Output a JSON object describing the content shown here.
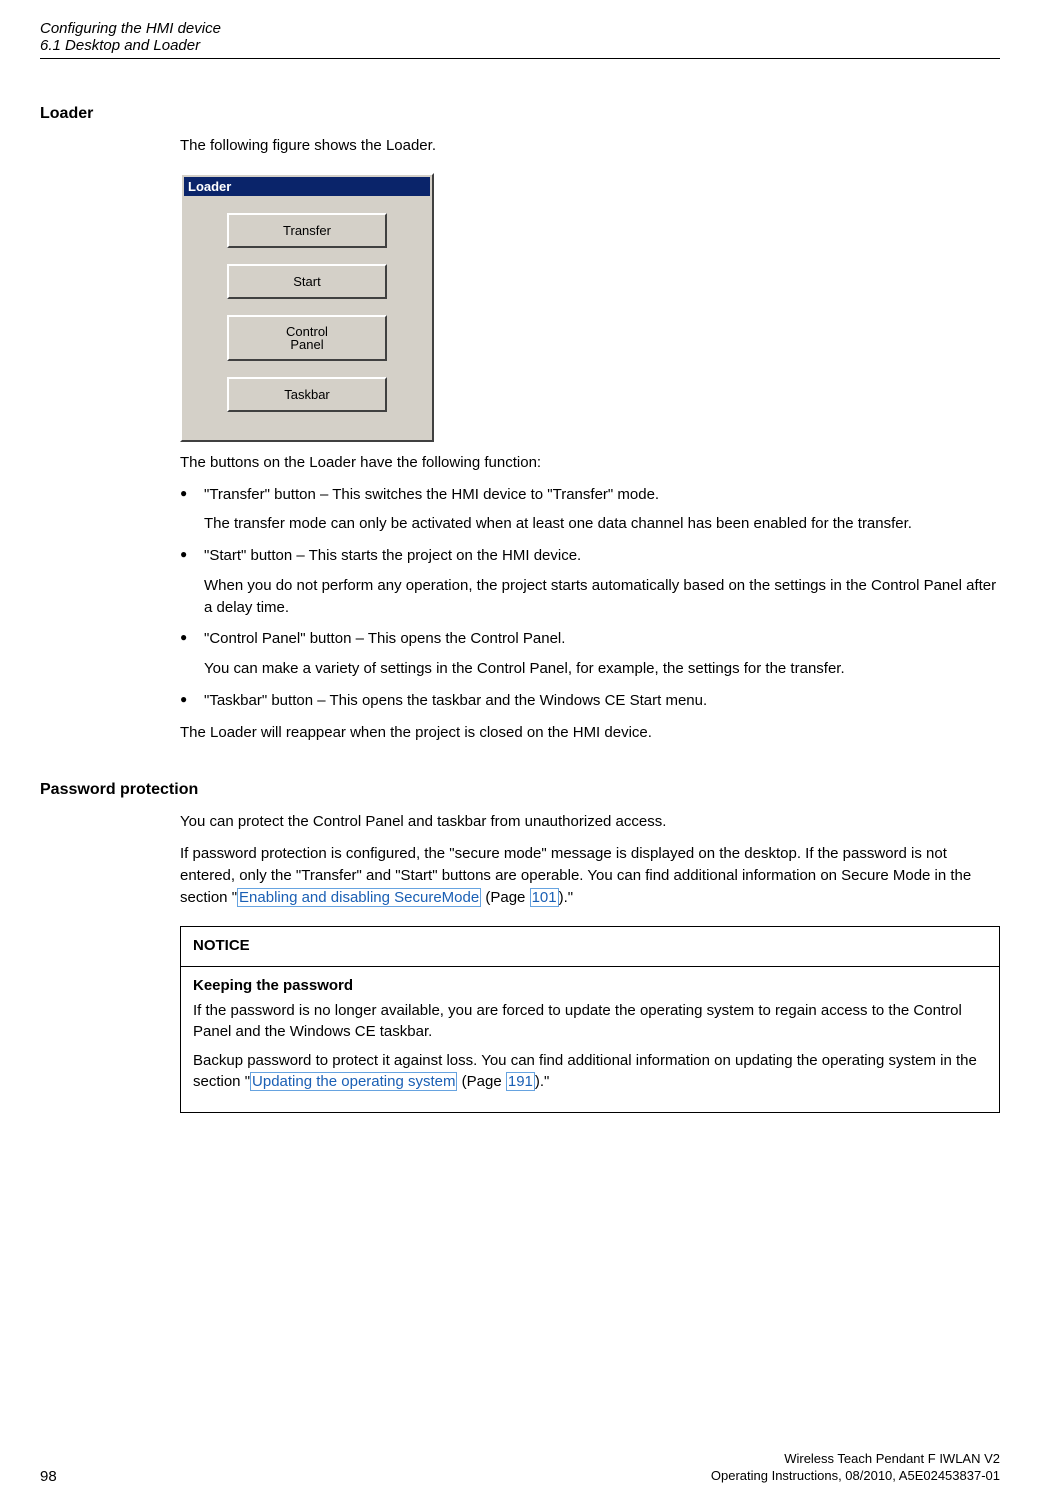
{
  "header": {
    "line1": "Configuring the HMI device",
    "line2": "6.1 Desktop and Loader"
  },
  "sections": {
    "loader": {
      "heading": "Loader",
      "intro": "The following figure shows the Loader.",
      "window": {
        "title": "Loader",
        "buttons": {
          "transfer": "Transfer",
          "start": "Start",
          "control_line1": "Control",
          "control_line2": "Panel",
          "taskbar": "Taskbar"
        }
      },
      "after_figure": "The buttons on the Loader have the following function:",
      "bullets": [
        {
          "main": "\"Transfer\" button – This switches the HMI device to \"Transfer\" mode.",
          "sub": "The transfer mode can only be activated when at least one data channel has been enabled for the transfer."
        },
        {
          "main": "\"Start\" button – This starts the project on the HMI device.",
          "sub": "When you do not perform any operation, the project starts automatically based on the settings in the Control Panel after a delay time."
        },
        {
          "main": "\"Control Panel\" button – This opens the Control Panel.",
          "sub": "You can make a variety of settings in the Control Panel, for example, the settings for the transfer."
        },
        {
          "main": "\"Taskbar\" button – This opens the taskbar and the Windows CE Start menu.",
          "sub": null
        }
      ],
      "closing": "The Loader will reappear when the project is closed on the HMI device."
    },
    "password": {
      "heading": "Password protection",
      "para1": "You can protect the Control Panel and taskbar from unauthorized access.",
      "para2_a": "If password protection is configured, the \"secure mode\" message is displayed on the desktop. If the password is not entered, only the \"Transfer\" and \"Start\" buttons are operable. You can find additional information on Secure Mode in the section \"",
      "link1_text": "Enabling and disabling SecureMode",
      "para2_mid": " (Page ",
      "link1_page": "101",
      "para2_end": ").\"",
      "notice": {
        "title": "NOTICE",
        "subtitle": "Keeping the password",
        "text1": "If the password is no longer available, you are forced to update the operating system to regain access to the Control Panel and the Windows CE taskbar.",
        "text2_a": "Backup password to protect it against loss. You can find additional information on updating the operating system in the section \"",
        "link2_text": "Updating the operating system",
        "text2_mid": " (Page ",
        "link2_page": "191",
        "text2_end": ").\""
      }
    }
  },
  "footer": {
    "product": "Wireless Teach Pendant F IWLAN V2",
    "docref": "Operating Instructions, 08/2010, A5E02453837-01",
    "page": "98"
  }
}
